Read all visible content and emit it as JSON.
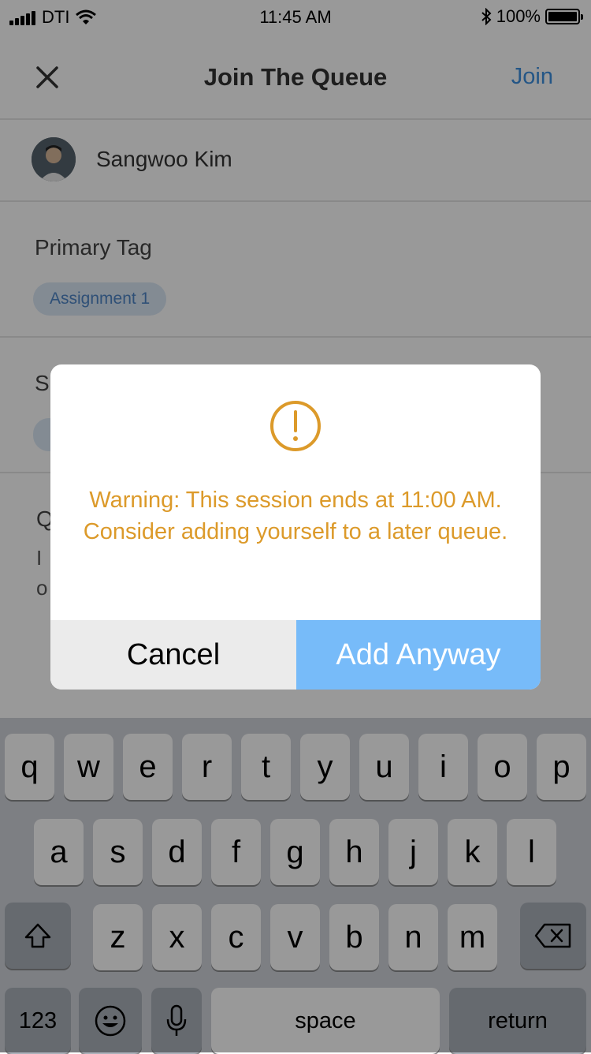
{
  "status_bar": {
    "carrier": "DTI",
    "time": "11:45 AM",
    "battery": "100%"
  },
  "nav": {
    "title": "Join The Queue",
    "join_label": "Join",
    "close_icon": "close-icon"
  },
  "user": {
    "name": "Sangwoo Kim"
  },
  "primary_tag": {
    "label": "Primary Tag",
    "chip": "Assignment 1"
  },
  "secondary_tag": {
    "label_fragment": "S"
  },
  "question": {
    "label_fragment": "Q",
    "line1_fragment": "I",
    "line2_fragment": "o"
  },
  "dialog": {
    "icon": "warning-icon",
    "message": "Warning: This session ends at 11:00 AM. Consider adding yourself to a later queue.",
    "cancel_label": "Cancel",
    "confirm_label": "Add Anyway",
    "warning_color": "#dc9a2a",
    "confirm_color": "#77bbf9"
  },
  "keyboard": {
    "row1": [
      "q",
      "w",
      "e",
      "r",
      "t",
      "y",
      "u",
      "i",
      "o",
      "p"
    ],
    "row2": [
      "a",
      "s",
      "d",
      "f",
      "g",
      "h",
      "j",
      "k",
      "l"
    ],
    "row3": [
      "z",
      "x",
      "c",
      "v",
      "b",
      "n",
      "m"
    ],
    "numbers_label": "123",
    "space_label": "space",
    "return_label": "return"
  }
}
